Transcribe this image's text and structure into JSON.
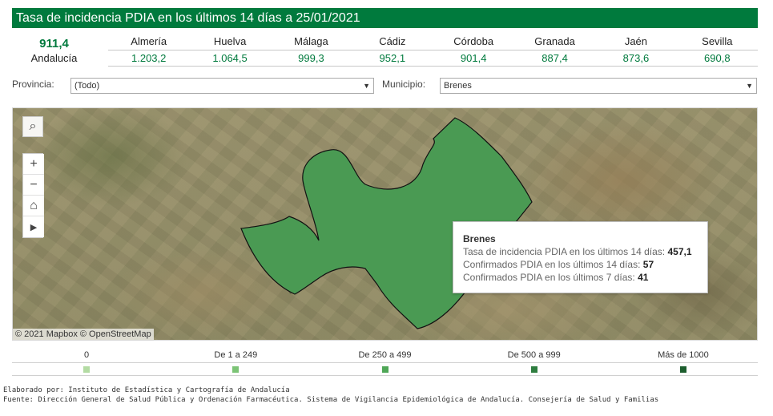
{
  "header": {
    "title": "Tasa de incidencia PDIA en los últimos 14 días a 25/01/2021"
  },
  "summary": {
    "total_value": "911,4",
    "total_label": "Andalucía",
    "provinces": [
      {
        "name": "Almería",
        "value": "1.203,2"
      },
      {
        "name": "Huelva",
        "value": "1.064,5"
      },
      {
        "name": "Málaga",
        "value": "999,3"
      },
      {
        "name": "Cádiz",
        "value": "952,1"
      },
      {
        "name": "Córdoba",
        "value": "901,4"
      },
      {
        "name": "Granada",
        "value": "887,4"
      },
      {
        "name": "Jaén",
        "value": "873,6"
      },
      {
        "name": "Sevilla",
        "value": "690,8"
      }
    ]
  },
  "filters": {
    "province_label": "Provincia:",
    "province_value": "(Todo)",
    "municipality_label": "Municipio:",
    "municipality_value": "Brenes"
  },
  "map": {
    "region_color": "#4a9a53",
    "tooltip": {
      "name": "Brenes",
      "line1_label": "Tasa de incidencia PDIA en los últimos 14 días:",
      "line1_value": "457,1",
      "line2_label": "Confirmados PDIA en los últimos 14 días:",
      "line2_value": "57",
      "line3_label": "Confirmados PDIA en los últimos 7 días:",
      "line3_value": "41"
    },
    "attribution": "© 2021 Mapbox © OpenStreetMap"
  },
  "legend": {
    "items": [
      {
        "label": "0",
        "color": "#b3dba3"
      },
      {
        "label": "De 1 a 249",
        "color": "#7cc476"
      },
      {
        "label": "De 250 a 499",
        "color": "#4fa757"
      },
      {
        "label": "De 500 a 999",
        "color": "#2e7d3f"
      },
      {
        "label": "Más de 1000",
        "color": "#1d5e2e"
      }
    ]
  },
  "footer": {
    "line1": "Elaborado por: Instituto de Estadística y Cartografía de Andalucía",
    "line2": "Fuente: Dirección General de Salud Pública y Ordenación Farmacéutica. Sistema de Vigilancia Epidemiológica de Andalucía. Consejería de Salud y Familias"
  }
}
